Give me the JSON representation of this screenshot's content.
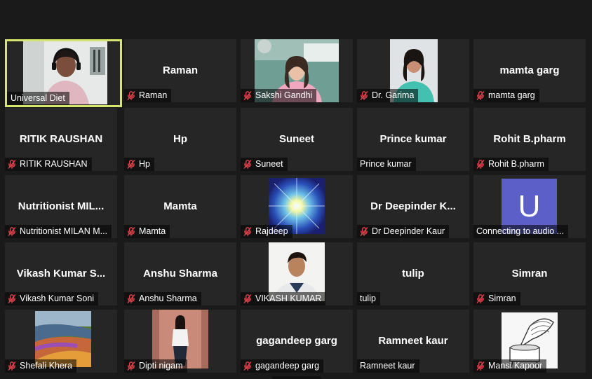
{
  "participants": [
    {
      "name": "Universal Diet",
      "muted": false,
      "video": "woman-headset",
      "active": true,
      "big": ""
    },
    {
      "name": "Raman",
      "muted": true,
      "video": "",
      "big": "Raman"
    },
    {
      "name": "Sakshi Gandhi",
      "muted": true,
      "video": "woman-pink",
      "big": ""
    },
    {
      "name": "Dr. Garima",
      "muted": true,
      "video": "woman-teal",
      "big": ""
    },
    {
      "name": "mamta garg",
      "muted": true,
      "video": "",
      "big": "mamta garg"
    },
    {
      "name": "RITIK RAUSHAN",
      "muted": true,
      "video": "",
      "big": "RITIK RAUSHAN"
    },
    {
      "name": "Hp",
      "muted": true,
      "video": "",
      "big": "Hp"
    },
    {
      "name": "Suneet",
      "muted": true,
      "video": "",
      "big": "Suneet"
    },
    {
      "name": "Prince kumar",
      "muted": false,
      "video": "",
      "big": "Prince kumar"
    },
    {
      "name": "Rohit B.pharm",
      "muted": true,
      "video": "",
      "big": "Rohit B.pharm"
    },
    {
      "name": "Nutritionist MILAN M...",
      "muted": true,
      "video": "",
      "big": "Nutritionist  MIL..."
    },
    {
      "name": "Mamta",
      "muted": true,
      "video": "",
      "big": "Mamta"
    },
    {
      "name": "Rajdeep",
      "muted": true,
      "video": "light-burst",
      "big": ""
    },
    {
      "name": "Dr Deepinder Kaur",
      "muted": true,
      "video": "",
      "big": "Dr  Deepinder  K..."
    },
    {
      "name": "Connecting to audio ...",
      "muted": false,
      "video": "avatar-u",
      "avatar_letter": "U",
      "big": ""
    },
    {
      "name": "Vikash Kumar Soni",
      "muted": true,
      "video": "",
      "big": "Vikash  Kumar  S..."
    },
    {
      "name": "Anshu Sharma",
      "muted": true,
      "video": "",
      "big": "Anshu Sharma"
    },
    {
      "name": "VIKASH KUMAR",
      "muted": true,
      "video": "man-white",
      "big": ""
    },
    {
      "name": "tulip",
      "muted": false,
      "video": "",
      "big": "tulip"
    },
    {
      "name": "Simran",
      "muted": true,
      "video": "",
      "big": "Simran"
    },
    {
      "name": "Shefali Khera",
      "muted": true,
      "video": "flowers",
      "big": ""
    },
    {
      "name": "Dipti nigam",
      "muted": true,
      "video": "woman-standing",
      "big": ""
    },
    {
      "name": "gagandeep garg",
      "muted": true,
      "video": "",
      "big": "gagandeep garg"
    },
    {
      "name": "Ramneet kaur",
      "muted": false,
      "video": "",
      "big": "Ramneet kaur"
    },
    {
      "name": "Mansi Kapoor",
      "muted": true,
      "video": "gramophone",
      "big": ""
    }
  ],
  "colors": {
    "active_border": "#d6e56e",
    "mute_icon": "#e0414a",
    "avatar_bg": "#5b5fc7",
    "tile_bg": "#262626"
  }
}
